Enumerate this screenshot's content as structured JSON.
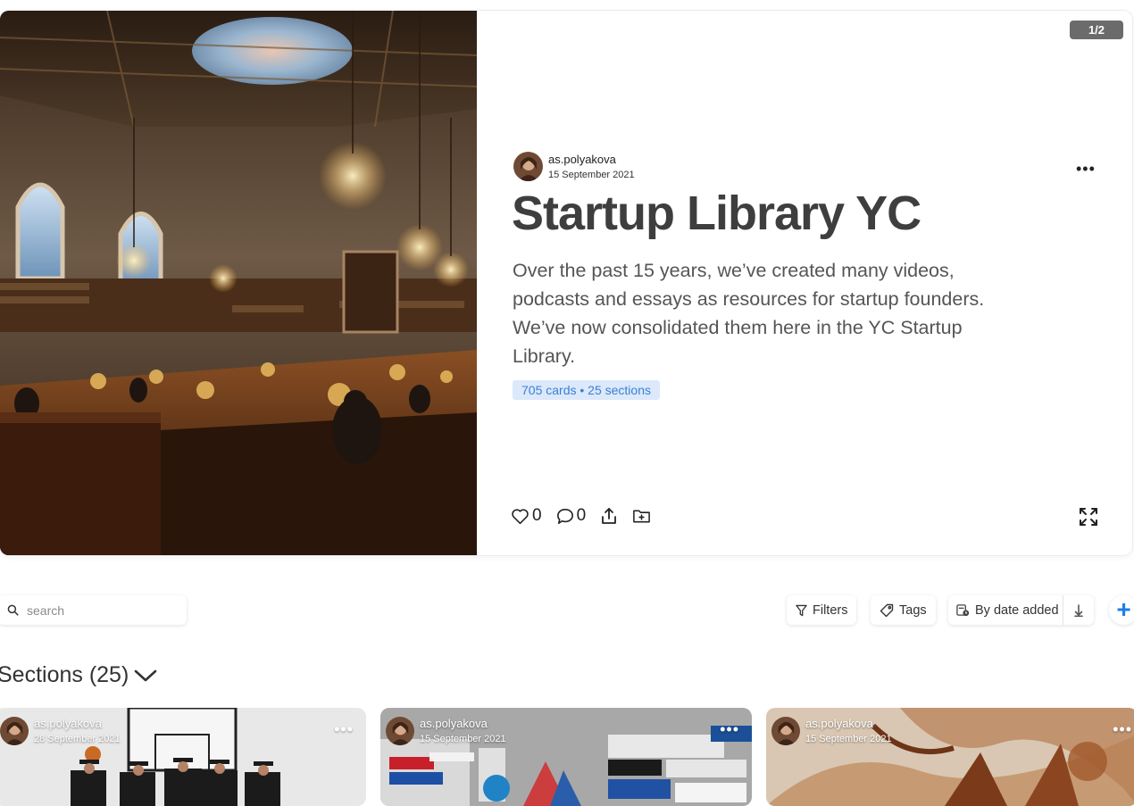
{
  "hero": {
    "page_counter": "1/2",
    "author": {
      "name": "as.polyakova",
      "date": "15 September 2021"
    },
    "title": "Startup Library YC",
    "description": "Over the past 15 years, we’ve created many videos, podcasts and essays as resources for startup founders. We’ve now consolidated them here in the YC Startup Library.",
    "badge": "705 cards • 25 sections",
    "likes": "0",
    "comments": "0"
  },
  "toolbar": {
    "search_placeholder": "search",
    "filters_label": "Filters",
    "tags_label": "Tags",
    "sort_label": "By date added",
    "add_label": "+"
  },
  "sections": {
    "heading": "Sections (25)",
    "cards": [
      {
        "author": "as.polyakova",
        "date": "28 September 2021"
      },
      {
        "author": "as.polyakova",
        "date": "15 September 2021"
      },
      {
        "author": "as.polyakova",
        "date": "15 September 2021"
      }
    ]
  },
  "icons": {
    "more": "more-icon",
    "heart": "heart-icon",
    "comment": "comment-icon",
    "share": "share-icon",
    "folder_add": "folder-add-icon",
    "expand": "expand-icon",
    "search": "search-icon",
    "filter": "filter-icon",
    "tag": "tag-icon",
    "sort": "sort-icon",
    "arrow_down": "arrow-down-icon",
    "chevron": "chevron-down-icon"
  },
  "colors": {
    "accent": "#1e7ee6",
    "badge_bg": "#dbe9fb",
    "badge_text": "#3b7fd4",
    "counter_bg": "#6b6b6b"
  }
}
